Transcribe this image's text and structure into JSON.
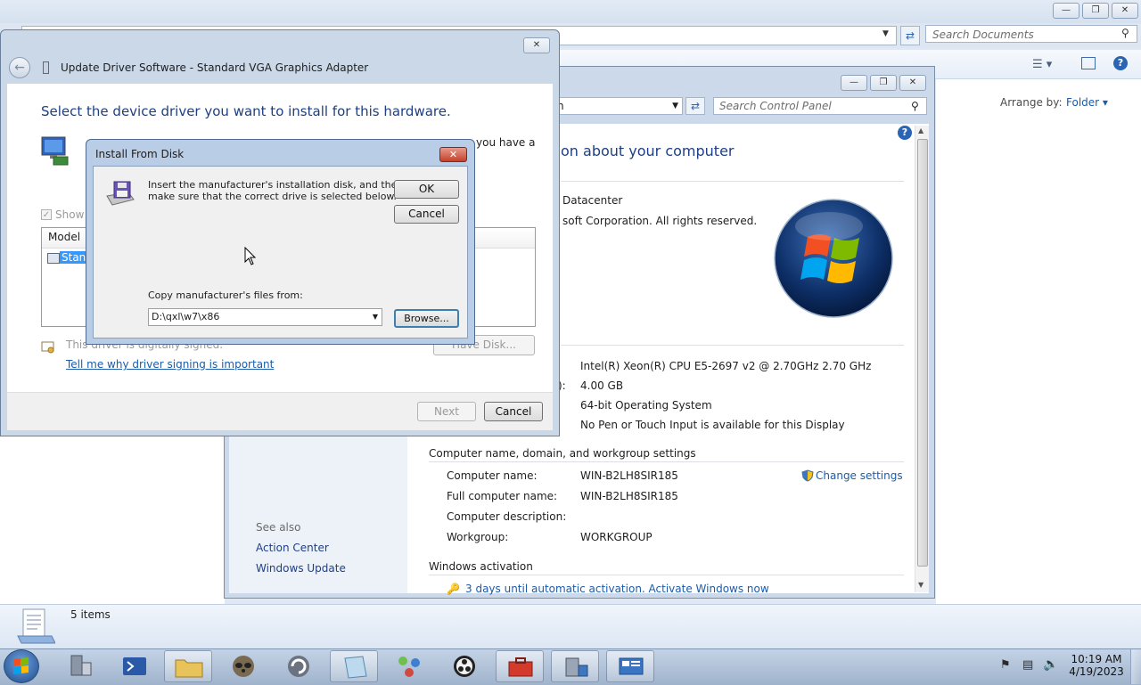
{
  "explorer": {
    "search_placeholder": "Search Documents",
    "arrange_by_label": "Arrange by:",
    "arrange_by_value": "Folder",
    "items_count": "5 items"
  },
  "control_panel": {
    "search_placeholder": "Search Control Panel",
    "address_fragment": "n",
    "heading": "on about your computer",
    "edition_fragment": "Datacenter",
    "copyright_fragment": "soft Corporation.  All rights reserved.",
    "processor_value": "Intel(R) Xeon(R) CPU E5-2697 v2 @ 2.70GHz   2.70 GHz",
    "ram_label_fragment": "):",
    "ram_value": "4.00 GB",
    "system_type_value": "64-bit Operating System",
    "pen_touch_value": "No Pen or Touch Input is available for this Display",
    "section_computer_name": "Computer name, domain, and workgroup settings",
    "computer_name_label": "Computer name:",
    "computer_name_value": "WIN-B2LH8SIR185",
    "full_name_label": "Full computer name:",
    "full_name_value": "WIN-B2LH8SIR185",
    "description_label": "Computer description:",
    "workgroup_label": "Workgroup:",
    "workgroup_value": "WORKGROUP",
    "change_settings": "Change settings",
    "section_activation": "Windows activation",
    "activation_text": "3 days until automatic activation. Activate Windows now",
    "see_also": "See also",
    "see_also_items": [
      "Action Center",
      "Windows Update"
    ]
  },
  "update_driver": {
    "title": "Update Driver Software - Standard VGA Graphics Adapter",
    "heading": "Select the device driver you want to install for this hardware.",
    "partial_text": "you have a",
    "show_compatible_fragment": "Show",
    "model_header": "Model",
    "model_item_fragment": "Stanc",
    "signed_text": "This driver is digitally signed.",
    "signing_link": "Tell me why driver signing is important",
    "have_disk": "Have Disk...",
    "next": "Next",
    "cancel": "Cancel"
  },
  "install_from_disk": {
    "title": "Install From Disk",
    "message_line1": "Insert the manufacturer's installation disk, and then",
    "message_line2": "make sure that the correct drive is selected below.",
    "ok": "OK",
    "cancel": "Cancel",
    "copy_from_label": "Copy manufacturer's files from:",
    "path_value": "D:\\qxl\\w7\\x86",
    "browse": "Browse..."
  },
  "taskbar": {
    "time": "10:19 AM",
    "date": "4/19/2023"
  }
}
